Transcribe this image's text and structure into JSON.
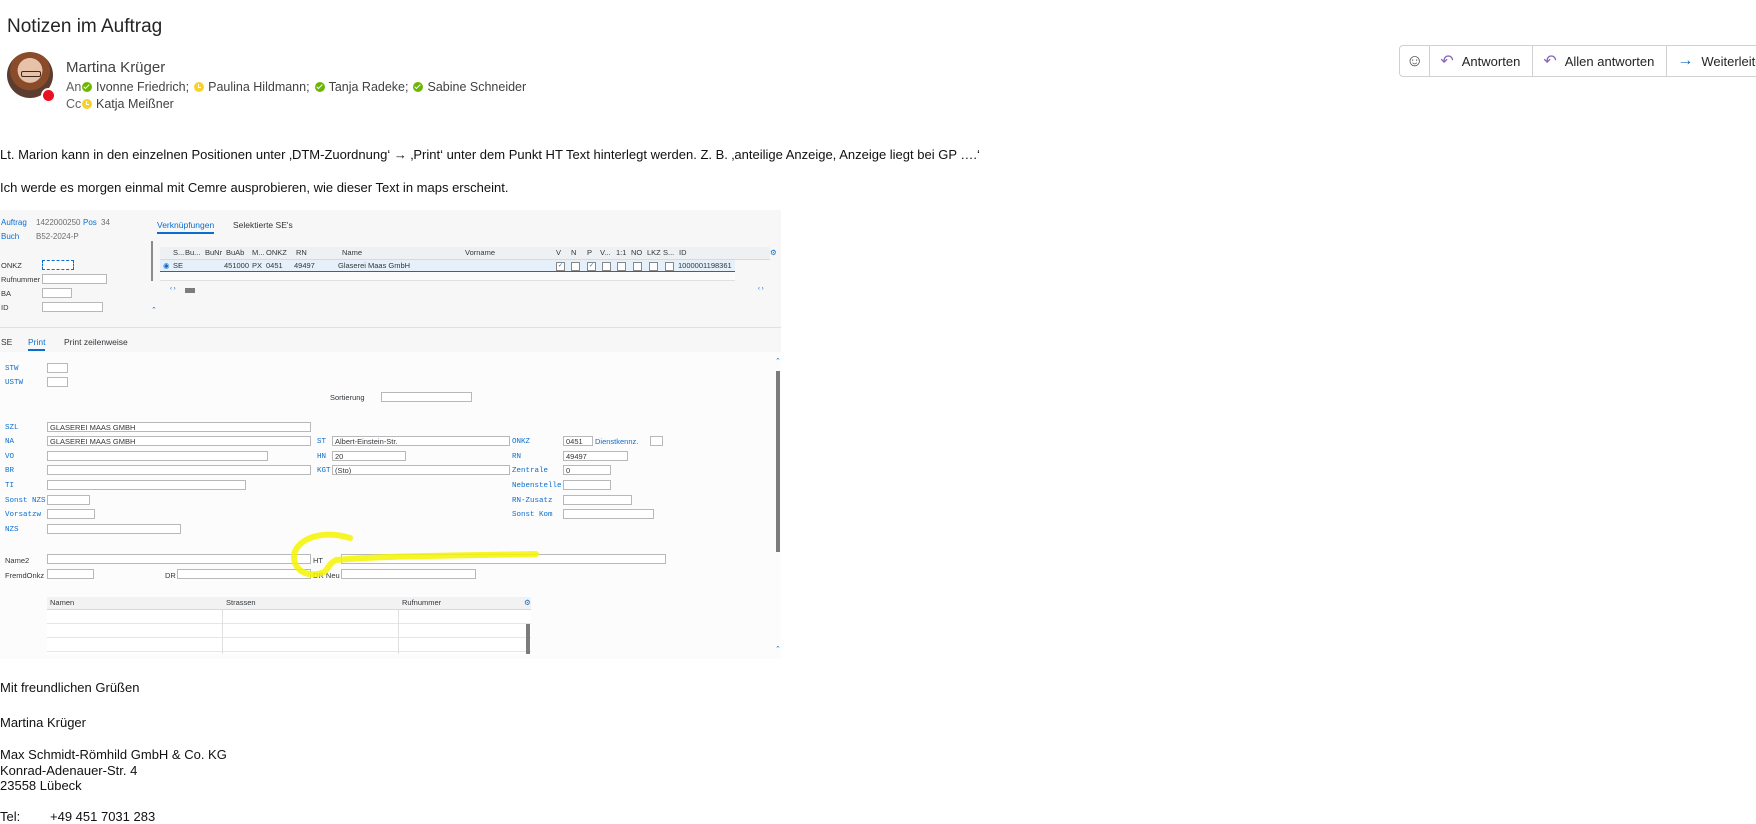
{
  "message": {
    "subject": "Notizen im Auftrag",
    "sender": "Martina Krüger",
    "to_label": "An",
    "cc_label": "Cc",
    "to": [
      {
        "name": "Ivonne Friedrich;",
        "status": "available"
      },
      {
        "name": "Paulina Hildmann;",
        "status": "away"
      },
      {
        "name": "Tanja Radeke;",
        "status": "available"
      },
      {
        "name": "Sabine Schneider",
        "status": "available"
      }
    ],
    "cc": [
      {
        "name": "Katja Meißner",
        "status": "away"
      }
    ],
    "body_lines": [
      "Lt. Marion kann in den einzelnen Positionen unter ‚DTM-Zuordnung‘ → ‚Print‘ unter dem Punkt HT Text hinterlegt werden. Z. B.  ‚anteilige Anzeige, Anzeige liegt bei GP ….‘",
      "Ich werde es morgen einmal mit Cemre ausprobieren, wie dieser Text in maps erscheint."
    ],
    "signature": {
      "greeting": "Mit freundlichen Grüßen",
      "name": "Martina Krüger",
      "company": "Max Schmidt-Römhild GmbH & Co. KG",
      "street": "Konrad-Adenauer-Str. 4",
      "city": "23558 Lübeck",
      "tel_label": "Tel:",
      "tel": "+49 451 7031 283"
    }
  },
  "actions": {
    "emoji_icon": "smiley-icon",
    "reply": "Antworten",
    "reply_all": "Allen antworten",
    "forward": "Weiterleiten"
  },
  "colors": {
    "accent": "#8764b8",
    "forward_accent": "#0f6cbd",
    "presence_available": "#6bb700",
    "presence_away": "#f8d22a",
    "presence_busy": "#e81123",
    "sap_link": "#0a6ed1",
    "highlight": "#f5f500"
  },
  "sap": {
    "header": {
      "auftrag_label": "Auftrag",
      "auftrag_value": "1422000250",
      "pos_label": "Pos",
      "pos_value": "34",
      "buch_label": "Buch",
      "buch_value": "B52-2024-P",
      "onkz_label": "ONKZ",
      "rufnummer_label": "Rufnummer",
      "ba_label": "BA",
      "id_label": "ID"
    },
    "top_tabs": [
      "Verknüpfungen",
      "Selektierte SE's"
    ],
    "grid": {
      "headers": [
        "S...",
        "Bu...",
        "BuNr",
        "BuAb",
        "M...",
        "ONKZ",
        "RN",
        "Name",
        "Vorname",
        "V",
        "N",
        "P",
        "V...",
        "1:1",
        "NO",
        "LKZ",
        "S...",
        "ID"
      ],
      "row": {
        "s": "SE",
        "buab": "451000",
        "m": "PX",
        "onkz": "0451",
        "rn": "49497",
        "name": "Glaserei Maas GmbH",
        "id": "1000001198361"
      }
    },
    "sub_tabs": [
      "SE",
      "Print",
      "Print zeilenweise"
    ],
    "form": {
      "stw": "STW",
      "ustw": "USTW",
      "sortierung": "Sortierung",
      "szl": "SZL",
      "szl_value": "GLASEREI MAAS GMBH",
      "na": "NA",
      "na_value": "GLASEREI MAAS GMBH",
      "vo": "VO",
      "br": "BR",
      "ti": "TI",
      "sonst_nzs": "Sonst NZS",
      "vorsatzw": "Vorsatzw",
      "nzs": "NZS",
      "st": "ST",
      "st_value": "Albert-Einstein-Str.",
      "hn": "HN",
      "hn_value": "20",
      "kgt": "KGT",
      "kgt_value": "(Sto)",
      "onkz": "ONKZ",
      "onkz_value": "0451",
      "dienstkennz": "Dienstkennz.",
      "rn": "RN",
      "rn_value": "49497",
      "zentrale": "Zentrale",
      "zentrale_value": "0",
      "nebenstelle": "Nebenstelle",
      "rn_zusatz": "RN-Zusatz",
      "sonst_kom": "Sonst Kom",
      "name2": "Name2",
      "ht": "HT",
      "fremdonkz": "FremdOnkz",
      "dr": "DR",
      "dr_neu": "DR Neu"
    },
    "bottom_grid": {
      "headers": [
        "Namen",
        "Strassen",
        "Rufnummer"
      ]
    }
  }
}
